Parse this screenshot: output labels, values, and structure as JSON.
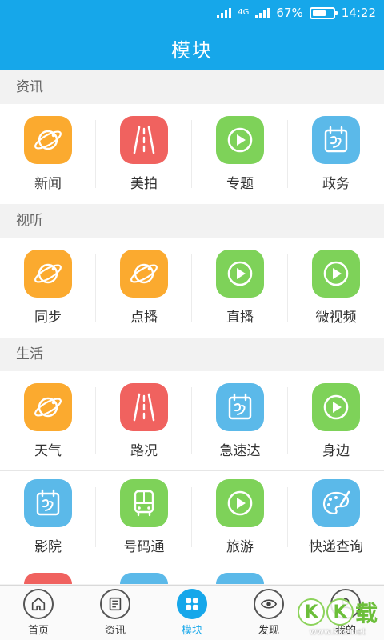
{
  "status": {
    "net": "4G",
    "battery": "67%",
    "time": "14:22"
  },
  "title": "模块",
  "sections": [
    {
      "title": "资讯",
      "items": [
        {
          "label": "新闻",
          "color": "#fbaa2f",
          "icon": "planet-icon"
        },
        {
          "label": "美拍",
          "color": "#f0625f",
          "icon": "road-icon"
        },
        {
          "label": "专题",
          "color": "#7ed259",
          "icon": "play-icon"
        },
        {
          "label": "政务",
          "color": "#5bb9e9",
          "icon": "calendar-icon"
        }
      ]
    },
    {
      "title": "视听",
      "items": [
        {
          "label": "同步",
          "color": "#fbaa2f",
          "icon": "planet-icon"
        },
        {
          "label": "点播",
          "color": "#fbaa2f",
          "icon": "planet-icon"
        },
        {
          "label": "直播",
          "color": "#7ed259",
          "icon": "play-icon"
        },
        {
          "label": "微视频",
          "color": "#7ed259",
          "icon": "play-icon"
        }
      ]
    },
    {
      "title": "生活",
      "items": [
        {
          "label": "天气",
          "color": "#fbaa2f",
          "icon": "planet-icon"
        },
        {
          "label": "路况",
          "color": "#f0625f",
          "icon": "road-icon"
        },
        {
          "label": "急速达",
          "color": "#5bb9e9",
          "icon": "calendar-icon"
        },
        {
          "label": "身边",
          "color": "#7ed259",
          "icon": "play-icon"
        },
        {
          "label": "影院",
          "color": "#5bb9e9",
          "icon": "calendar-icon"
        },
        {
          "label": "号码通",
          "color": "#7ed259",
          "icon": "bus-icon"
        },
        {
          "label": "旅游",
          "color": "#7ed259",
          "icon": "play-icon"
        },
        {
          "label": "快递查询",
          "color": "#5bb9e9",
          "icon": "palette-icon"
        }
      ]
    }
  ],
  "tabs": [
    {
      "label": "首页",
      "icon": "home-icon",
      "active": false
    },
    {
      "label": "资讯",
      "icon": "news-icon",
      "active": false
    },
    {
      "label": "模块",
      "icon": "grid-icon",
      "active": true
    },
    {
      "label": "发现",
      "icon": "eye-icon",
      "active": false
    },
    {
      "label": "我的",
      "icon": "user-icon",
      "active": false
    }
  ],
  "watermark": {
    "brand": "KK",
    "suffix": "载",
    "url": "www.kkx.net"
  }
}
